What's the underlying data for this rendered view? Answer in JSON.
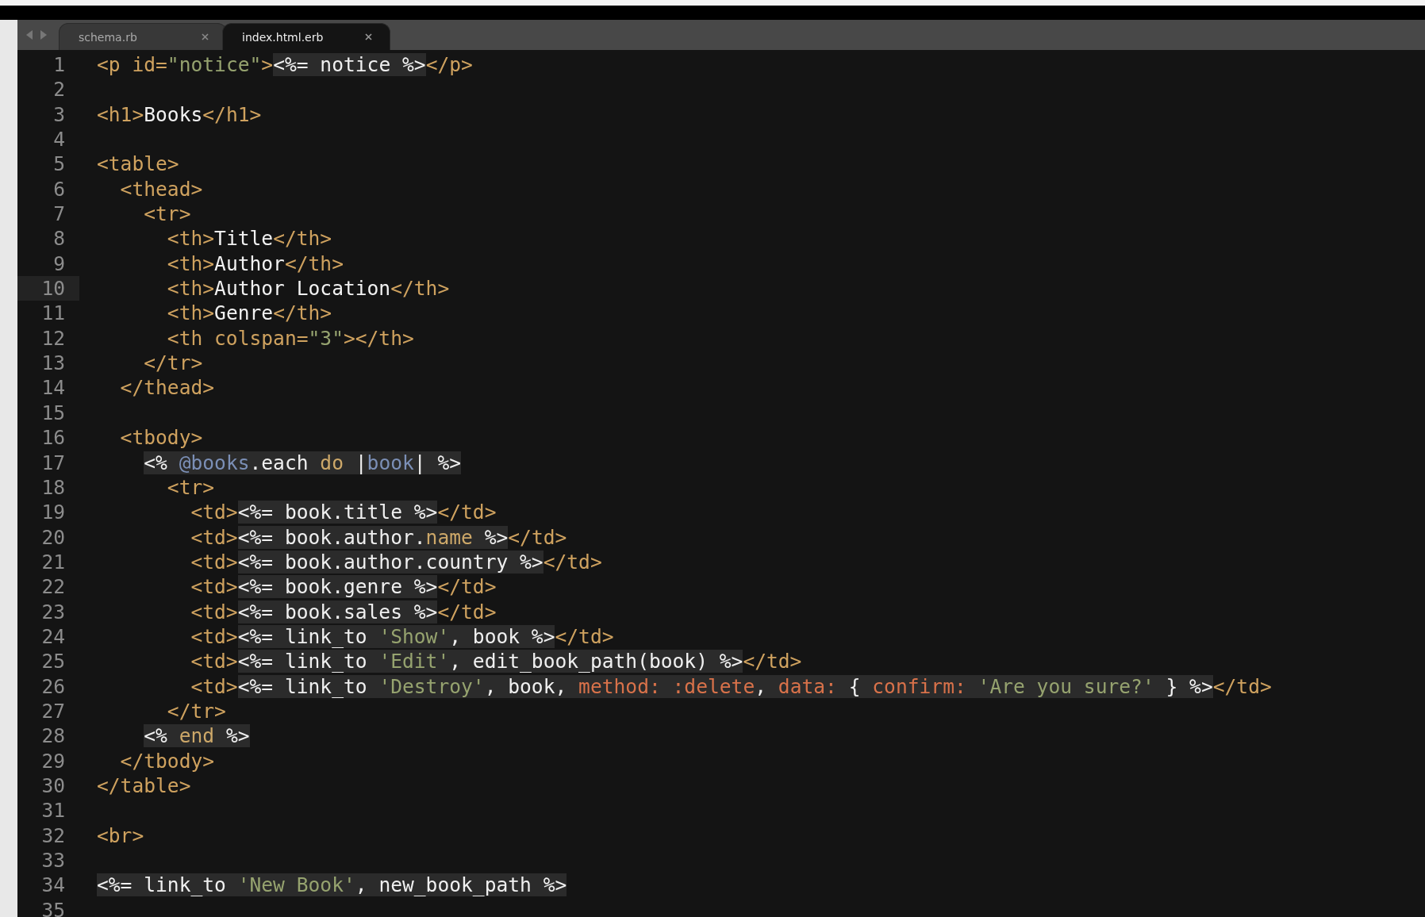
{
  "tabs": [
    {
      "label": "schema.rb",
      "selected": false
    },
    {
      "label": "index.html.erb",
      "selected": true
    }
  ],
  "lines": [
    {
      "number": "1",
      "current": false,
      "segments": [
        {
          "kind": "markup",
          "tokens": [
            {
              "kind": "tag",
              "text": "<p id="
            },
            {
              "kind": "string",
              "text": "\"notice\""
            },
            {
              "kind": "tag",
              "text": ">"
            }
          ]
        },
        {
          "kind": "embedded",
          "tokens": [
            {
              "kind": "code",
              "text": "<%= notice %>"
            }
          ]
        },
        {
          "kind": "markup",
          "tokens": [
            {
              "kind": "tag",
              "text": "</p>"
            }
          ]
        }
      ]
    },
    {
      "number": "2",
      "current": false
    },
    {
      "number": "3",
      "current": false,
      "segments": [
        {
          "kind": "markup",
          "tokens": [
            {
              "kind": "tag",
              "text": "<h1>"
            },
            {
              "kind": "text",
              "text": "Books"
            },
            {
              "kind": "tag",
              "text": "</h1>"
            }
          ]
        }
      ]
    },
    {
      "number": "4",
      "current": false
    },
    {
      "number": "5",
      "current": false,
      "segments": [
        {
          "kind": "markup",
          "tokens": [
            {
              "kind": "tag",
              "text": "<table>"
            }
          ]
        }
      ]
    },
    {
      "number": "6",
      "current": false,
      "segments": [
        {
          "kind": "markup",
          "tokens": [
            {
              "kind": "tag",
              "text": "  <thead>"
            }
          ]
        }
      ]
    },
    {
      "number": "7",
      "current": false,
      "segments": [
        {
          "kind": "markup",
          "tokens": [
            {
              "kind": "tag",
              "text": "    <tr>"
            }
          ]
        }
      ]
    },
    {
      "number": "8",
      "current": false,
      "segments": [
        {
          "kind": "markup",
          "tokens": [
            {
              "kind": "tag",
              "text": "      <th>"
            },
            {
              "kind": "text",
              "text": "Title"
            },
            {
              "kind": "tag",
              "text": "</th>"
            }
          ]
        }
      ]
    },
    {
      "number": "9",
      "current": false,
      "segments": [
        {
          "kind": "markup",
          "tokens": [
            {
              "kind": "tag",
              "text": "      <th>"
            },
            {
              "kind": "text",
              "text": "Author"
            },
            {
              "kind": "tag",
              "text": "</th>"
            }
          ]
        }
      ]
    },
    {
      "number": "10",
      "current": true,
      "segments": [
        {
          "kind": "markup",
          "tokens": [
            {
              "kind": "tag",
              "text": "      <th>"
            },
            {
              "kind": "text",
              "text": "Author Location"
            },
            {
              "kind": "tag",
              "text": "</th>"
            }
          ]
        }
      ]
    },
    {
      "number": "11",
      "current": false,
      "segments": [
        {
          "kind": "markup",
          "tokens": [
            {
              "kind": "tag",
              "text": "      <th>"
            },
            {
              "kind": "text",
              "text": "Genre"
            },
            {
              "kind": "tag",
              "text": "</th>"
            }
          ]
        }
      ]
    },
    {
      "number": "12",
      "current": false,
      "segments": [
        {
          "kind": "markup",
          "tokens": [
            {
              "kind": "tag",
              "text": "      <th colspan="
            },
            {
              "kind": "string",
              "text": "\"3\""
            },
            {
              "kind": "tag",
              "text": "></th>"
            }
          ]
        }
      ]
    },
    {
      "number": "13",
      "current": false,
      "segments": [
        {
          "kind": "markup",
          "tokens": [
            {
              "kind": "tag",
              "text": "    </tr>"
            }
          ]
        }
      ]
    },
    {
      "number": "14",
      "current": false,
      "segments": [
        {
          "kind": "markup",
          "tokens": [
            {
              "kind": "tag",
              "text": "  </thead>"
            }
          ]
        }
      ]
    },
    {
      "number": "15",
      "current": false
    },
    {
      "number": "16",
      "current": false,
      "segments": [
        {
          "kind": "markup",
          "tokens": [
            {
              "kind": "tag",
              "text": "  <tbody>"
            }
          ]
        }
      ]
    },
    {
      "number": "17",
      "current": false,
      "segments": [
        {
          "kind": "embedded",
          "tokens": [
            {
              "kind": "code",
              "text": "    <% "
            },
            {
              "kind": "variable",
              "text": "@books"
            },
            {
              "kind": "code",
              "text": ".each "
            },
            {
              "kind": "keyword",
              "text": "do"
            },
            {
              "kind": "code",
              "text": " |"
            },
            {
              "kind": "variable",
              "text": "book"
            },
            {
              "kind": "code",
              "text": "| %>"
            }
          ]
        }
      ]
    },
    {
      "number": "18",
      "current": false,
      "segments": [
        {
          "kind": "markup",
          "tokens": [
            {
              "kind": "tag",
              "text": "      <tr>"
            }
          ]
        }
      ]
    },
    {
      "number": "19",
      "current": false,
      "segments": [
        {
          "kind": "markup",
          "tokens": [
            {
              "kind": "tag",
              "text": "        <td>"
            }
          ]
        },
        {
          "kind": "embedded",
          "tokens": [
            {
              "kind": "code",
              "text": "<%= book.title %>"
            }
          ]
        },
        {
          "kind": "markup",
          "tokens": [
            {
              "kind": "tag",
              "text": "</td>"
            }
          ]
        }
      ]
    },
    {
      "number": "20",
      "current": false,
      "segments": [
        {
          "kind": "markup",
          "tokens": [
            {
              "kind": "tag",
              "text": "        <td>"
            }
          ]
        },
        {
          "kind": "embedded",
          "tokens": [
            {
              "kind": "code",
              "text": "<%= book.author."
            },
            {
              "kind": "keyword",
              "text": "name"
            },
            {
              "kind": "code",
              "text": " %>"
            }
          ]
        },
        {
          "kind": "markup",
          "tokens": [
            {
              "kind": "tag",
              "text": "</td>"
            }
          ]
        }
      ]
    },
    {
      "number": "21",
      "current": false,
      "segments": [
        {
          "kind": "markup",
          "tokens": [
            {
              "kind": "tag",
              "text": "        <td>"
            }
          ]
        },
        {
          "kind": "embedded",
          "tokens": [
            {
              "kind": "code",
              "text": "<%= book.author.country %>"
            }
          ]
        },
        {
          "kind": "markup",
          "tokens": [
            {
              "kind": "tag",
              "text": "</td>"
            }
          ]
        }
      ]
    },
    {
      "number": "22",
      "current": false,
      "segments": [
        {
          "kind": "markup",
          "tokens": [
            {
              "kind": "tag",
              "text": "        <td>"
            }
          ]
        },
        {
          "kind": "embedded",
          "tokens": [
            {
              "kind": "code",
              "text": "<%= book.genre %>"
            }
          ]
        },
        {
          "kind": "markup",
          "tokens": [
            {
              "kind": "tag",
              "text": "</td>"
            }
          ]
        }
      ]
    },
    {
      "number": "23",
      "current": false,
      "segments": [
        {
          "kind": "markup",
          "tokens": [
            {
              "kind": "tag",
              "text": "        <td>"
            }
          ]
        },
        {
          "kind": "embedded",
          "tokens": [
            {
              "kind": "code",
              "text": "<%= book.sales %>"
            }
          ]
        },
        {
          "kind": "markup",
          "tokens": [
            {
              "kind": "tag",
              "text": "</td>"
            }
          ]
        }
      ]
    },
    {
      "number": "24",
      "current": false,
      "segments": [
        {
          "kind": "markup",
          "tokens": [
            {
              "kind": "tag",
              "text": "        <td>"
            }
          ]
        },
        {
          "kind": "embedded",
          "tokens": [
            {
              "kind": "code",
              "text": "<%= link_to "
            },
            {
              "kind": "string",
              "text": "'Show'"
            },
            {
              "kind": "code",
              "text": ", book %>"
            }
          ]
        },
        {
          "kind": "markup",
          "tokens": [
            {
              "kind": "tag",
              "text": "</td>"
            }
          ]
        }
      ]
    },
    {
      "number": "25",
      "current": false,
      "segments": [
        {
          "kind": "markup",
          "tokens": [
            {
              "kind": "tag",
              "text": "        <td>"
            }
          ]
        },
        {
          "kind": "embedded",
          "tokens": [
            {
              "kind": "code",
              "text": "<%= link_to "
            },
            {
              "kind": "string",
              "text": "'Edit'"
            },
            {
              "kind": "code",
              "text": ", edit_book_path(book) %>"
            }
          ]
        },
        {
          "kind": "markup",
          "tokens": [
            {
              "kind": "tag",
              "text": "</td>"
            }
          ]
        }
      ]
    },
    {
      "number": "26",
      "current": false,
      "segments": [
        {
          "kind": "markup",
          "tokens": [
            {
              "kind": "tag",
              "text": "        <td>"
            }
          ]
        },
        {
          "kind": "embedded",
          "tokens": [
            {
              "kind": "code",
              "text": "<%= link_to "
            },
            {
              "kind": "string",
              "text": "'Destroy'"
            },
            {
              "kind": "code",
              "text": ", book, "
            },
            {
              "kind": "symbol",
              "text": "method: :delete"
            },
            {
              "kind": "code",
              "text": ", "
            },
            {
              "kind": "symbol",
              "text": "data:"
            },
            {
              "kind": "code",
              "text": " { "
            },
            {
              "kind": "symbol",
              "text": "confirm:"
            },
            {
              "kind": "string",
              "text": " 'Are you sure?'"
            },
            {
              "kind": "code",
              "text": " } %>"
            }
          ]
        },
        {
          "kind": "markup",
          "tokens": [
            {
              "kind": "tag",
              "text": "</td>"
            }
          ]
        }
      ]
    },
    {
      "number": "27",
      "current": false,
      "segments": [
        {
          "kind": "markup",
          "tokens": [
            {
              "kind": "tag",
              "text": "      </tr>"
            }
          ]
        }
      ]
    },
    {
      "number": "28",
      "current": false,
      "segments": [
        {
          "kind": "embedded",
          "tokens": [
            {
              "kind": "code",
              "text": "    <% "
            },
            {
              "kind": "keyword",
              "text": "end"
            },
            {
              "kind": "code",
              "text": " %>"
            }
          ]
        }
      ]
    },
    {
      "number": "29",
      "current": false,
      "segments": [
        {
          "kind": "markup",
          "tokens": [
            {
              "kind": "tag",
              "text": "  </tbody>"
            }
          ]
        }
      ]
    },
    {
      "number": "30",
      "current": false,
      "segments": [
        {
          "kind": "markup",
          "tokens": [
            {
              "kind": "tag",
              "text": "</table>"
            }
          ]
        }
      ]
    },
    {
      "number": "31",
      "current": false
    },
    {
      "number": "32",
      "current": false,
      "segments": [
        {
          "kind": "markup",
          "tokens": [
            {
              "kind": "tag",
              "text": "<br>"
            }
          ]
        }
      ]
    },
    {
      "number": "33",
      "current": false
    },
    {
      "number": "34",
      "current": false,
      "segments": [
        {
          "kind": "embedded",
          "tokens": [
            {
              "kind": "code",
              "text": "<%= link_to "
            },
            {
              "kind": "string",
              "text": "'New Book'"
            },
            {
              "kind": "code",
              "text": ", new_book_path %>"
            }
          ]
        }
      ]
    },
    {
      "number": "35",
      "current": false
    }
  ]
}
